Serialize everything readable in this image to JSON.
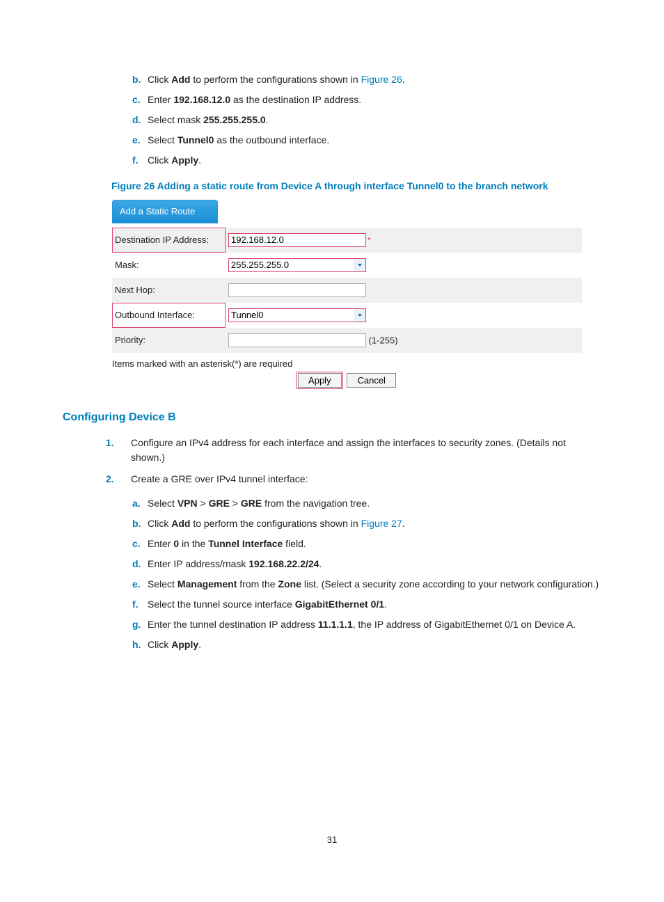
{
  "steps_top": {
    "b": {
      "pre": "Click ",
      "bold": "Add",
      "mid": " to perform the configurations shown in ",
      "link": "Figure 26",
      "post": "."
    },
    "c": {
      "pre": "Enter ",
      "bold": "192.168.12.0",
      "post": " as the destination IP address."
    },
    "d": {
      "pre": "Select mask ",
      "bold": "255.255.255.0",
      "post": "."
    },
    "e": {
      "pre": "Select ",
      "bold": "Tunnel0",
      "post": " as the outbound interface."
    },
    "f": {
      "pre": "Click ",
      "bold": "Apply",
      "post": "."
    }
  },
  "figure26_caption": "Figure 26 Adding a static route from Device A through interface Tunnel0 to the branch network",
  "form": {
    "tab": "Add a Static Route",
    "dest_label": "Destination IP Address:",
    "dest_value": "192.168.12.0",
    "mask_label": "Mask:",
    "mask_value": "255.255.255.0",
    "nexthop_label": "Next Hop:",
    "nexthop_value": "",
    "outif_label": "Outbound Interface:",
    "outif_value": "Tunnel0",
    "priority_label": "Priority:",
    "priority_value": "",
    "priority_hint": "(1-255)",
    "required_note": "Items marked with an asterisk(*) are required",
    "apply": "Apply",
    "cancel": "Cancel"
  },
  "section_heading": "Configuring Device B",
  "steps_num": {
    "1": "Configure an IPv4 address for each interface and assign the interfaces to security zones. (Details not shown.)",
    "2": "Create a GRE over IPv4 tunnel interface:"
  },
  "steps_sub": {
    "a": {
      "pre": "Select ",
      "b1": "VPN",
      "s1": " > ",
      "b2": "GRE",
      "s2": " > ",
      "b3": "GRE",
      "post": " from the navigation tree."
    },
    "b": {
      "pre": "Click ",
      "bold": "Add",
      "mid": " to perform the configurations shown in ",
      "link": "Figure 27",
      "post": "."
    },
    "c": {
      "pre": "Enter ",
      "bold": "0",
      "mid": " in the ",
      "bold2": "Tunnel Interface",
      "post": " field."
    },
    "d": {
      "pre": "Enter IP address/mask ",
      "bold": "192.168.22.2/24",
      "post": "."
    },
    "e": {
      "pre": "Select ",
      "bold": "Management",
      "mid": " from the ",
      "bold2": "Zone",
      "post": " list. (Select a security zone according to your network configuration.)"
    },
    "f": {
      "pre": "Select the tunnel source interface ",
      "bold": "GigabitEthernet 0/1",
      "post": "."
    },
    "g": {
      "pre": "Enter the tunnel destination IP address ",
      "bold": "11.1.1.1",
      "post": ", the IP address of GigabitEthernet 0/1 on Device A."
    },
    "h": {
      "pre": "Click ",
      "bold": "Apply",
      "post": "."
    }
  },
  "page_number": "31"
}
